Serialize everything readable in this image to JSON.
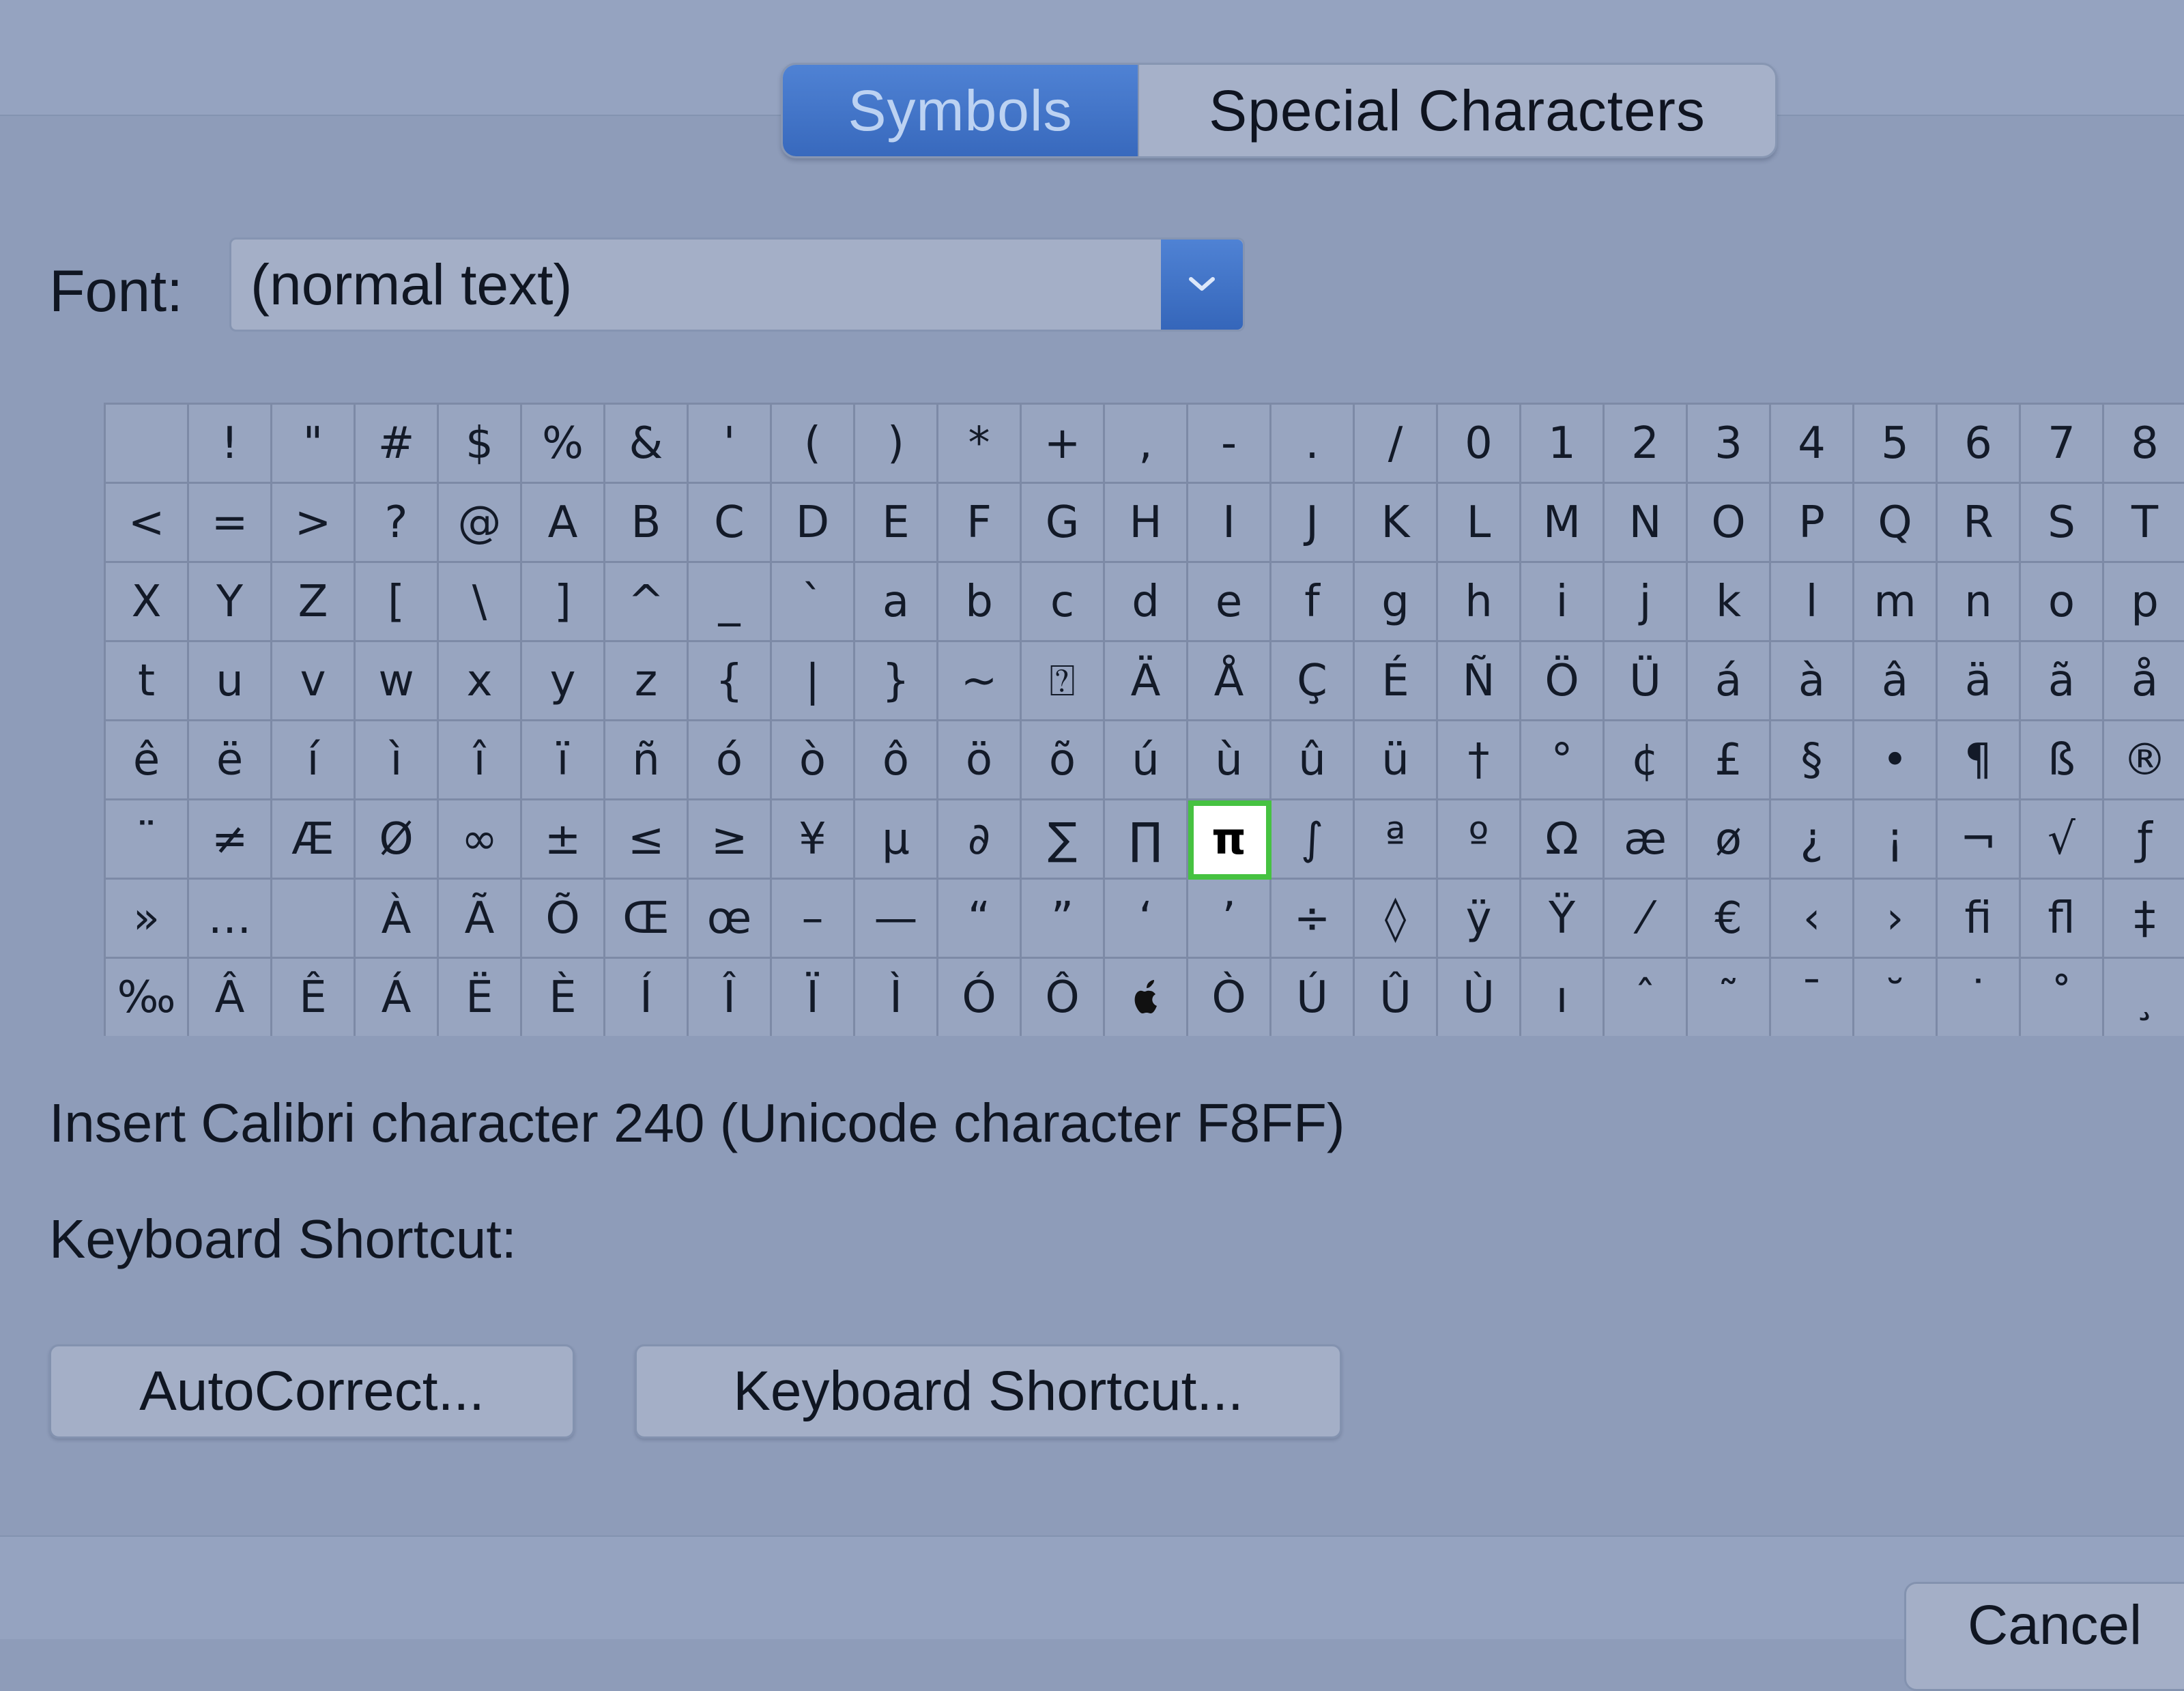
{
  "tabs": [
    {
      "label": "Symbols",
      "active": true
    },
    {
      "label": "Special Characters",
      "active": false
    }
  ],
  "font": {
    "label": "Font:",
    "value": "(normal text)"
  },
  "grid": {
    "selected": "π",
    "rows": [
      [
        " ",
        "!",
        "\"",
        "#",
        "$",
        "%",
        "&",
        "'",
        "(",
        ")",
        "*",
        "+",
        ",",
        "-",
        ".",
        "/",
        "0",
        "1",
        "2",
        "3",
        "4",
        "5",
        "6",
        "7",
        "8"
      ],
      [
        "<",
        "=",
        ">",
        "?",
        "@",
        "A",
        "B",
        "C",
        "D",
        "E",
        "F",
        "G",
        "H",
        "I",
        "J",
        "K",
        "L",
        "M",
        "N",
        "O",
        "P",
        "Q",
        "R",
        "S",
        "T"
      ],
      [
        "X",
        "Y",
        "Z",
        "[",
        "\\",
        "]",
        "^",
        "_",
        "`",
        "a",
        "b",
        "c",
        "d",
        "e",
        "f",
        "g",
        "h",
        "i",
        "j",
        "k",
        "l",
        "m",
        "n",
        "o",
        "p"
      ],
      [
        "t",
        "u",
        "v",
        "w",
        "x",
        "y",
        "z",
        "{",
        "|",
        "}",
        "~",
        "⍰",
        "Ä",
        "Å",
        "Ç",
        "É",
        "Ñ",
        "Ö",
        "Ü",
        "á",
        "à",
        "â",
        "ä",
        "ã",
        "å"
      ],
      [
        "ê",
        "ë",
        "í",
        "ì",
        "î",
        "ï",
        "ñ",
        "ó",
        "ò",
        "ô",
        "ö",
        "õ",
        "ú",
        "ù",
        "û",
        "ü",
        "†",
        "°",
        "¢",
        "£",
        "§",
        "•",
        "¶",
        "ß",
        "®"
      ],
      [
        "¨",
        "≠",
        "Æ",
        "Ø",
        "∞",
        "±",
        "≤",
        "≥",
        "¥",
        "µ",
        "∂",
        "∑",
        "∏",
        "π",
        "∫",
        "ª",
        "º",
        "Ω",
        "æ",
        "ø",
        "¿",
        "¡",
        "¬",
        "√",
        "ƒ"
      ],
      [
        "»",
        "…",
        " ",
        "À",
        "Ã",
        "Õ",
        "Œ",
        "œ",
        "–",
        "—",
        "“",
        "”",
        "‘",
        "’",
        "÷",
        "◊",
        "ÿ",
        "Ÿ",
        "⁄",
        "€",
        "‹",
        "›",
        "ﬁ",
        "ﬂ",
        "‡"
      ],
      [
        "‰",
        "Â",
        "Ê",
        "Á",
        "Ë",
        "È",
        "Í",
        "Î",
        "Ï",
        "Ì",
        "Ó",
        "Ô",
        "",
        "Ò",
        "Ú",
        "Û",
        "Ù",
        "ı",
        "ˆ",
        "˜",
        "¯",
        "˘",
        "˙",
        "˚",
        "¸"
      ]
    ]
  },
  "info": {
    "char_text": "Insert Calibri character 240  (Unicode character F8FF)",
    "shortcut_label": "Keyboard Shortcut:"
  },
  "buttons": {
    "autocorrect": "AutoCorrect...",
    "keyboard_shortcut": "Keyboard Shortcut...",
    "cancel": "Cancel"
  },
  "colors": {
    "accent": "#3d72c8",
    "selection_border": "#46c241"
  }
}
